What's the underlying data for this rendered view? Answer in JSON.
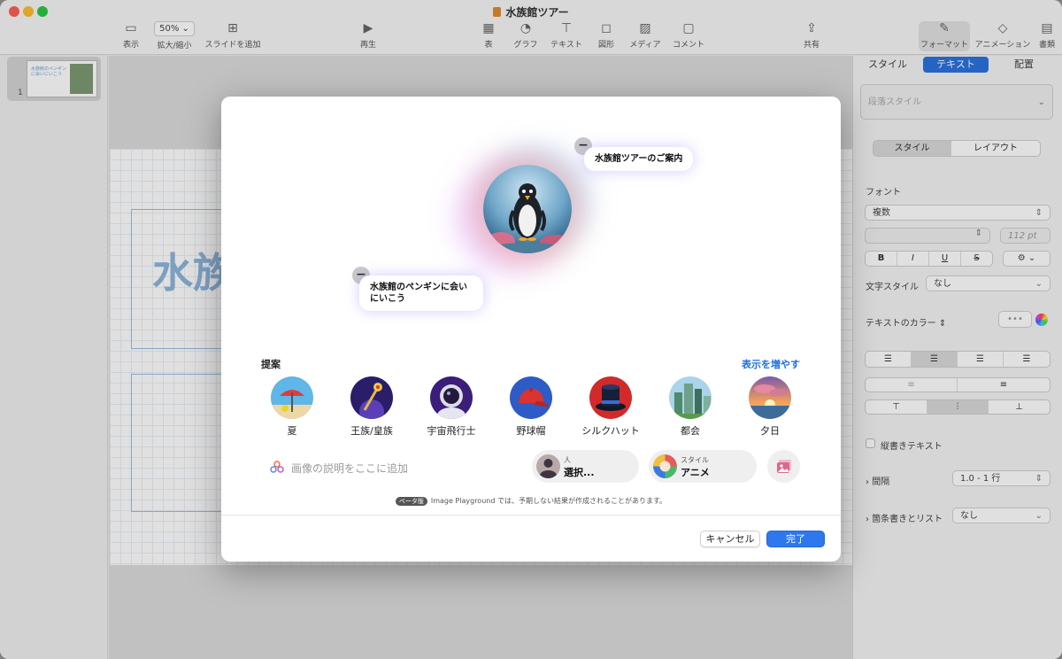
{
  "window": {
    "title": "水族館ツアー"
  },
  "toolbar": {
    "view": "表示",
    "zoom_value": "50%",
    "zoom": "拡大/縮小",
    "add_slide": "スライドを追加",
    "play": "再生",
    "table": "表",
    "chart": "グラフ",
    "text": "テキスト",
    "shape": "図形",
    "media": "メディア",
    "comment": "コメント",
    "share": "共有",
    "format": "フォーマット",
    "animate": "アニメーション",
    "document": "書類"
  },
  "slide_nav": {
    "number": "1",
    "thumb_text": "水族館のペンギンに会いにいこう"
  },
  "slide": {
    "big_text": "水族"
  },
  "inspector": {
    "tabs": [
      "スタイル",
      "テキスト",
      "配置"
    ],
    "paragraph_style": "段落スタイル",
    "seg": [
      "スタイル",
      "レイアウト"
    ],
    "font_label": "フォント",
    "font_value": "複数",
    "font_size": "112 pt",
    "format_buttons": [
      "B",
      "I",
      "U",
      "S"
    ],
    "char_style_label": "文字スタイル",
    "char_style_value": "なし",
    "text_color_label": "テキストのカラー",
    "vertical_text": "縦書きテキスト",
    "spacing_label": "間隔",
    "spacing_value": "1.0 - 1 行",
    "bullets_label": "箇条書きとリスト",
    "bullets_value": "なし"
  },
  "playground": {
    "bubble_top": "水族館ツアーのご案内",
    "bubble_left": "水族館のペンギンに会いにいこう",
    "suggestions_title": "提案",
    "show_more": "表示を増やす",
    "suggestions": [
      "夏",
      "王族/皇族",
      "宇宙飛行士",
      "野球帽",
      "シルクハット",
      "都会",
      "夕日"
    ],
    "description_placeholder": "画像の説明をここに追加",
    "person_caption": "人",
    "person_value": "選択...",
    "style_caption": "スタイル",
    "style_value": "アニメ",
    "beta_badge": "ベータ版",
    "notice": "Image Playground では、予期しない結果が作成されることがあります。",
    "cancel": "キャンセル",
    "done": "完了"
  },
  "colors": {
    "accent": "#2e78ee",
    "link": "#1a6fe8"
  }
}
